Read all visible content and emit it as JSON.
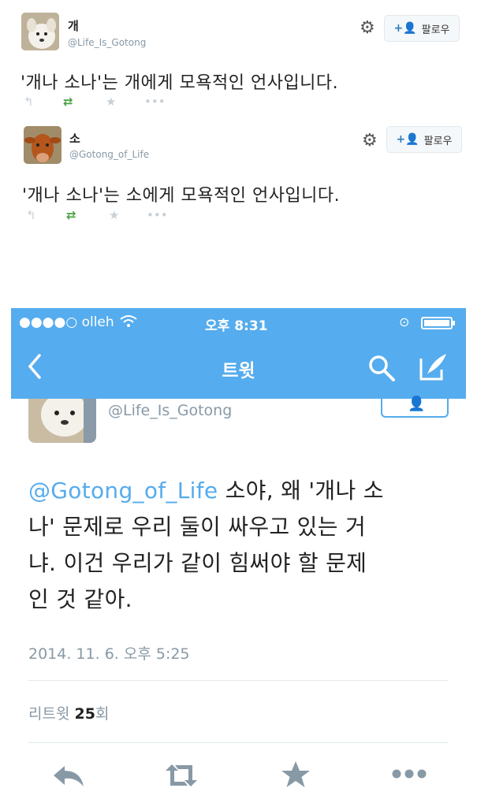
{
  "tweet1": {
    "name": "개",
    "handle": "@Life_Is_Gotong",
    "text": "'개나 소나'는 개에게 모욕적인 언사입니다.",
    "follow_label": "팔로우"
  },
  "tweet2": {
    "name": "소",
    "handle": "@Gotong_of_Life",
    "text": "'개나 소나'는 소에게 모욕적인 언사입니다.",
    "follow_label": "팔로우"
  },
  "phone": {
    "status": {
      "carrier": "●●●●○ olleh",
      "time": "오후 8:31"
    },
    "nav": {
      "title": "트윗"
    },
    "handle": "@Life_Is_Gotong",
    "mention": "@Gotong_of_Life",
    "line1_rest": " 소야, 왜 '개나 소",
    "line2": "나' 문제로 우리 둘이 싸우고 있는 거",
    "line3": "냐. 이건 우리가 같이 힘써야 할 문제",
    "line4": "인 것 같아.",
    "timestamp": "2014. 11. 6. 오후 5:25",
    "retweet_label": "리트윗",
    "retweet_count": "25",
    "retweet_suffix": "회"
  },
  "colors": {
    "twitter_blue": "#55acee",
    "retweet_green": "#49a144"
  },
  "icons": [
    "gear-icon",
    "add-user-icon",
    "reply-icon",
    "retweet-icon",
    "favorite-icon",
    "more-icon",
    "wifi-icon",
    "battery-icon",
    "back-icon",
    "search-icon",
    "compose-icon"
  ]
}
